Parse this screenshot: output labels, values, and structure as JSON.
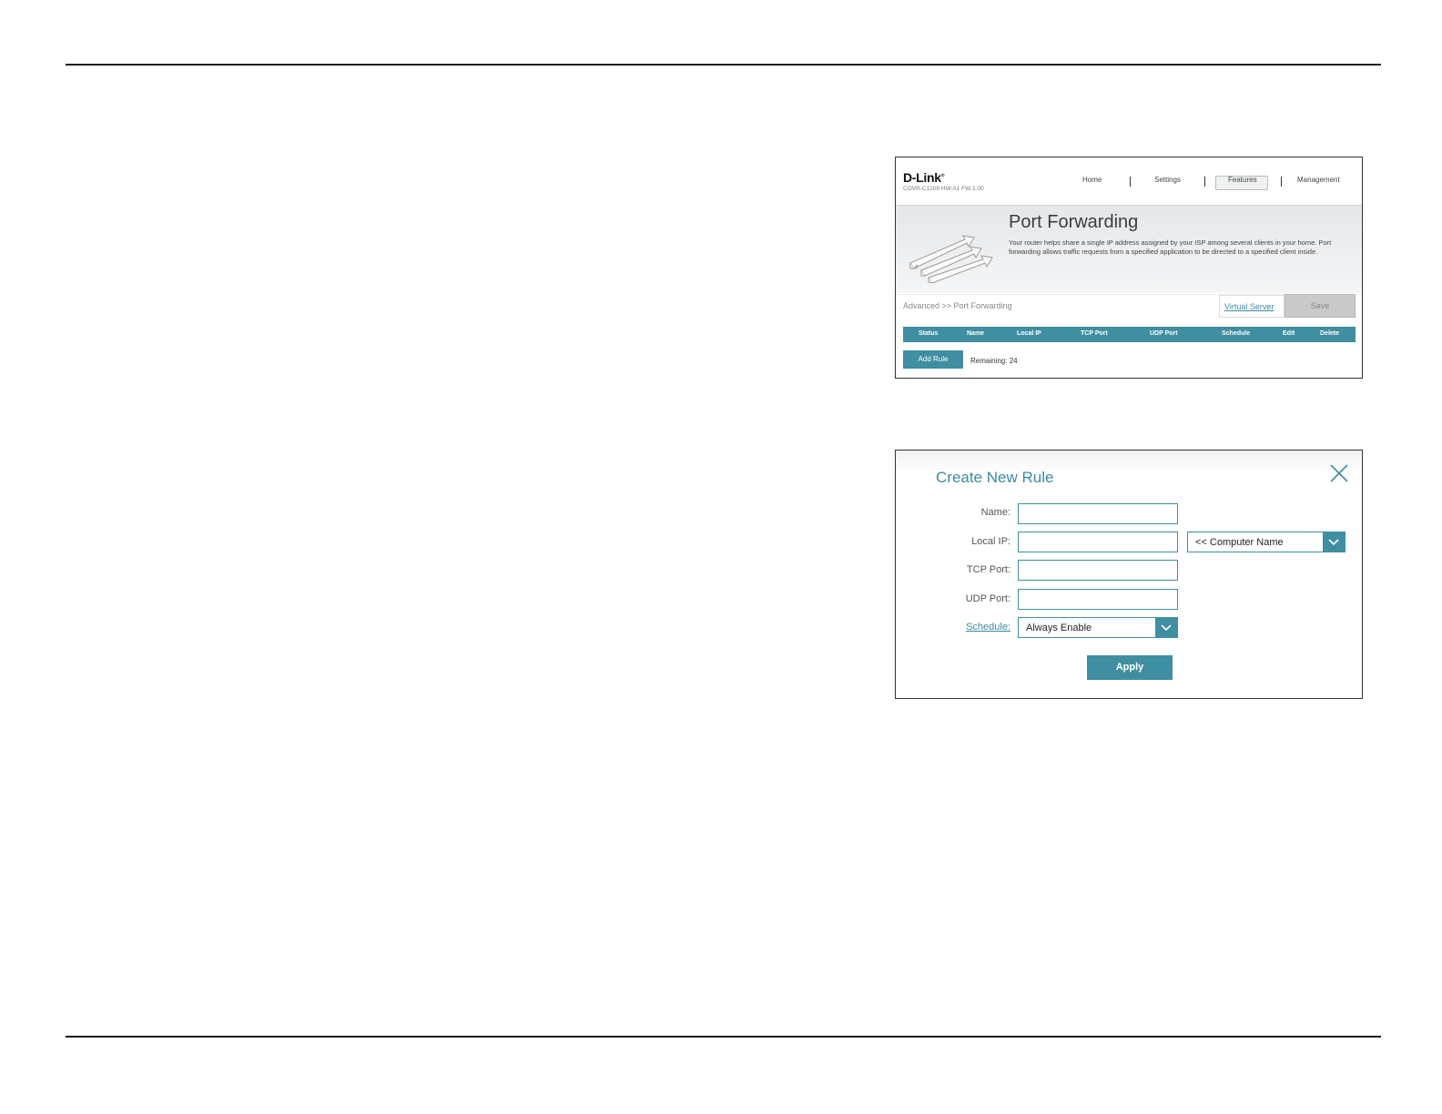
{
  "router_page": {
    "logo": "D-Link",
    "logo_mark": "®",
    "model": "COVR-C1200 HW:A1 FW:1.00",
    "nav": {
      "home": "Home",
      "settings": "Settings",
      "features": "Features",
      "management": "Management"
    },
    "title": "Port Forwarding",
    "description": "Your router helps share a single IP address assigned by your ISP among several clients in your home. Port forwarding allows traffic requests from a specified application to be directed to a specified client inside.",
    "breadcrumb": "Advanced >> Port Forwarding",
    "virtual_server_link": "Virtual Server",
    "save_label": "Save",
    "table_headers": [
      "Status",
      "Name",
      "Local IP",
      "TCP Port",
      "UDP Port",
      "Schedule",
      "Edit",
      "Delete"
    ],
    "add_rule_label": "Add Rule",
    "remaining_text": "Remaining: 24"
  },
  "dialog": {
    "title": "Create New Rule",
    "name_label": "Name:",
    "local_ip_label": "Local IP:",
    "computer_name_select": "<< Computer Name",
    "tcp_port_label": "TCP Port:",
    "udp_port_label": "UDP Port:",
    "schedule_label": "Schedule:",
    "schedule_select": "Always Enable",
    "apply_label": "Apply"
  },
  "colors": {
    "accent": "#3f8ea1",
    "link": "#3d8aa1"
  }
}
